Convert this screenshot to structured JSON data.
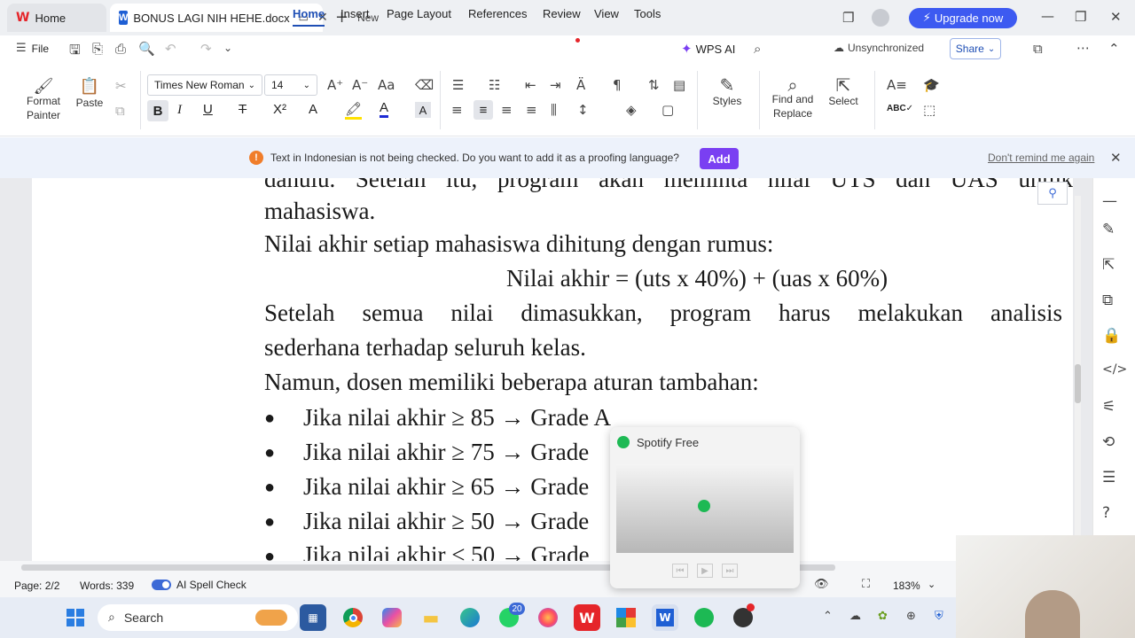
{
  "tabs": {
    "home": "Home",
    "doc": "BONUS LAGI NIH HEHE.docx",
    "new": "New"
  },
  "topright": {
    "upgrade": "Upgrade now"
  },
  "menu": {
    "file": "File",
    "items": [
      "Home",
      "Insert",
      "Page Layout",
      "References",
      "Review",
      "View",
      "Tools",
      "WPS AI"
    ],
    "unsync": "Unsynchronized",
    "share": "Share"
  },
  "ribbon": {
    "format_painter": "Format Painter",
    "paste": "Paste",
    "font": "Times New Roman",
    "size": "14",
    "styles": "Styles",
    "find_replace": "Find and Replace",
    "select": "Select"
  },
  "notification": {
    "text": "Text in Indonesian is not being checked. Do you want to add it as a proofing language?",
    "add": "Add",
    "dont_remind": "Don't remind me again"
  },
  "document": {
    "line1": "dahulu. Setelah itu, program akan meminta nilai UTS dan UAS untuk",
    "line2": "mahasiswa.",
    "line3": "Nilai akhir setiap mahasiswa dihitung dengan rumus:",
    "formula": "Nilai akhir = (uts x 40%) + (uas x 60%)",
    "line5": "Setelah semua nilai dimasukkan, program harus melakukan analisis",
    "line6": "sederhana terhadap seluruh kelas.",
    "line7": "Namun, dosen memiliki beberapa aturan tambahan:",
    "bullets": [
      "Jika nilai akhir ≥ 85 → Grade A",
      "Jika nilai akhir ≥ 75 → Grade",
      "Jika nilai akhir ≥ 65 → Grade",
      "Jika nilai akhir ≥ 50 → Grade",
      "Jika nilai akhir < 50 → Grade"
    ]
  },
  "status": {
    "page": "Page: 2/2",
    "words": "Words: 339",
    "spell": "AI Spell Check",
    "zoom": "183%"
  },
  "spotify": {
    "title": "Spotify Free"
  },
  "taskbar": {
    "search": "Search",
    "whatsapp_badge": "20"
  },
  "colors": {
    "accent": "#1f4fb5",
    "upgrade": "#3d5af1",
    "add": "#7a3ff2",
    "wps_red": "#e5252a",
    "spotify": "#1db954"
  }
}
